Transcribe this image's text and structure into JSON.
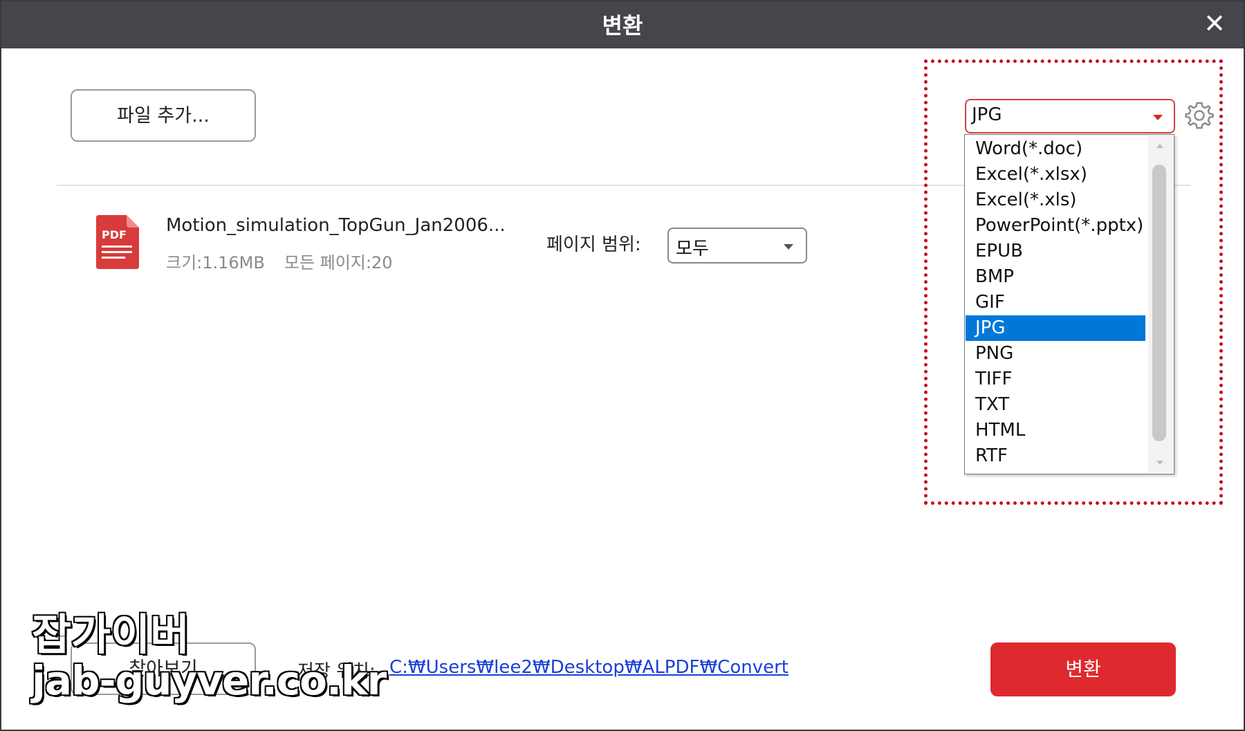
{
  "window": {
    "title": "변환"
  },
  "toolbar": {
    "add_file_label": "파일 추가..."
  },
  "file": {
    "name": "Motion_simulation_TopGun_Jan2006...",
    "size": "크기:1.16MB",
    "pages": "모든 페이지:20",
    "icon_text": "PDF"
  },
  "page_range": {
    "label": "페이지 범위:",
    "value": "모두"
  },
  "format": {
    "selected": "JPG",
    "options": [
      "Word(*.doc)",
      "Excel(*.xlsx)",
      "Excel(*.xls)",
      "PowerPoint(*.pptx)",
      "EPUB",
      "BMP",
      "GIF",
      "JPG",
      "PNG",
      "TIFF",
      "TXT",
      "HTML",
      "RTF"
    ],
    "selected_index": 7
  },
  "footer": {
    "browse_label": "찾아보기",
    "save_location_label": "저장 위치:",
    "save_path": "C:₩Users₩lee2₩Desktop₩ALPDF₩Convert",
    "convert_label": "변환"
  },
  "watermark": {
    "line1": "잡가이버",
    "line2": "jab-guyver.co.kr"
  },
  "colors": {
    "accent": "#de2a2e",
    "selection": "#0078d7",
    "highlight_border": "#c40e23",
    "titlebar": "#45464b"
  },
  "icons": {
    "close": "close-icon",
    "settings": "gear-icon",
    "file": "pdf-file-icon"
  }
}
